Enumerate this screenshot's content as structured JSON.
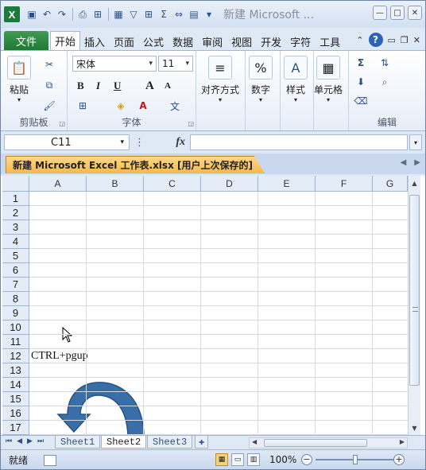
{
  "window": {
    "title": "新建 Microsoft ..."
  },
  "quick_access": [
    "save-icon",
    "undo-icon",
    "redo-icon",
    "print-preview-icon",
    "layout-icon",
    "calendar-icon",
    "filter-icon",
    "borders-icon",
    "autosum-icon",
    "merge-icon",
    "form-icon"
  ],
  "ribbon_tabs": [
    "文件",
    "开始",
    "插入",
    "页面",
    "公式",
    "数据",
    "审阅",
    "视图",
    "开发",
    "字符",
    "工具"
  ],
  "ribbon": {
    "clipboard": {
      "paste_label": "粘贴",
      "group_label": "剪贴板"
    },
    "font": {
      "name": "宋体",
      "size": "11",
      "bold": "B",
      "italic": "I",
      "underline": "U",
      "grow": "A",
      "shrink": "A",
      "group_label": "字体"
    },
    "align": {
      "label": "对齐方式"
    },
    "number": {
      "label": "数字",
      "icon": "%"
    },
    "styles": {
      "label": "样式"
    },
    "cells": {
      "label": "单元格"
    },
    "editing": {
      "group_label": "编辑"
    }
  },
  "formula_bar": {
    "name_box": "C11",
    "fx": "fx",
    "value": ""
  },
  "document_tab": {
    "label": "新建 Microsoft Excel 工作表.xlsx [用户上次保存的]"
  },
  "grid": {
    "columns": [
      "A",
      "B",
      "C",
      "D",
      "E",
      "F",
      "G"
    ],
    "rows": [
      "1",
      "2",
      "3",
      "4",
      "5",
      "6",
      "7",
      "8",
      "9",
      "10",
      "11",
      "12",
      "13",
      "14",
      "15",
      "16",
      "17"
    ],
    "cells": [
      {
        "ref": "A12",
        "value": "CTRL+pgup"
      }
    ]
  },
  "sheets": {
    "tabs": [
      "Sheet1",
      "Sheet2",
      "Sheet3"
    ],
    "active": "Sheet2"
  },
  "status": {
    "ready": "就绪",
    "zoom": "100%",
    "zoom_minus": "−",
    "zoom_plus": "+"
  }
}
